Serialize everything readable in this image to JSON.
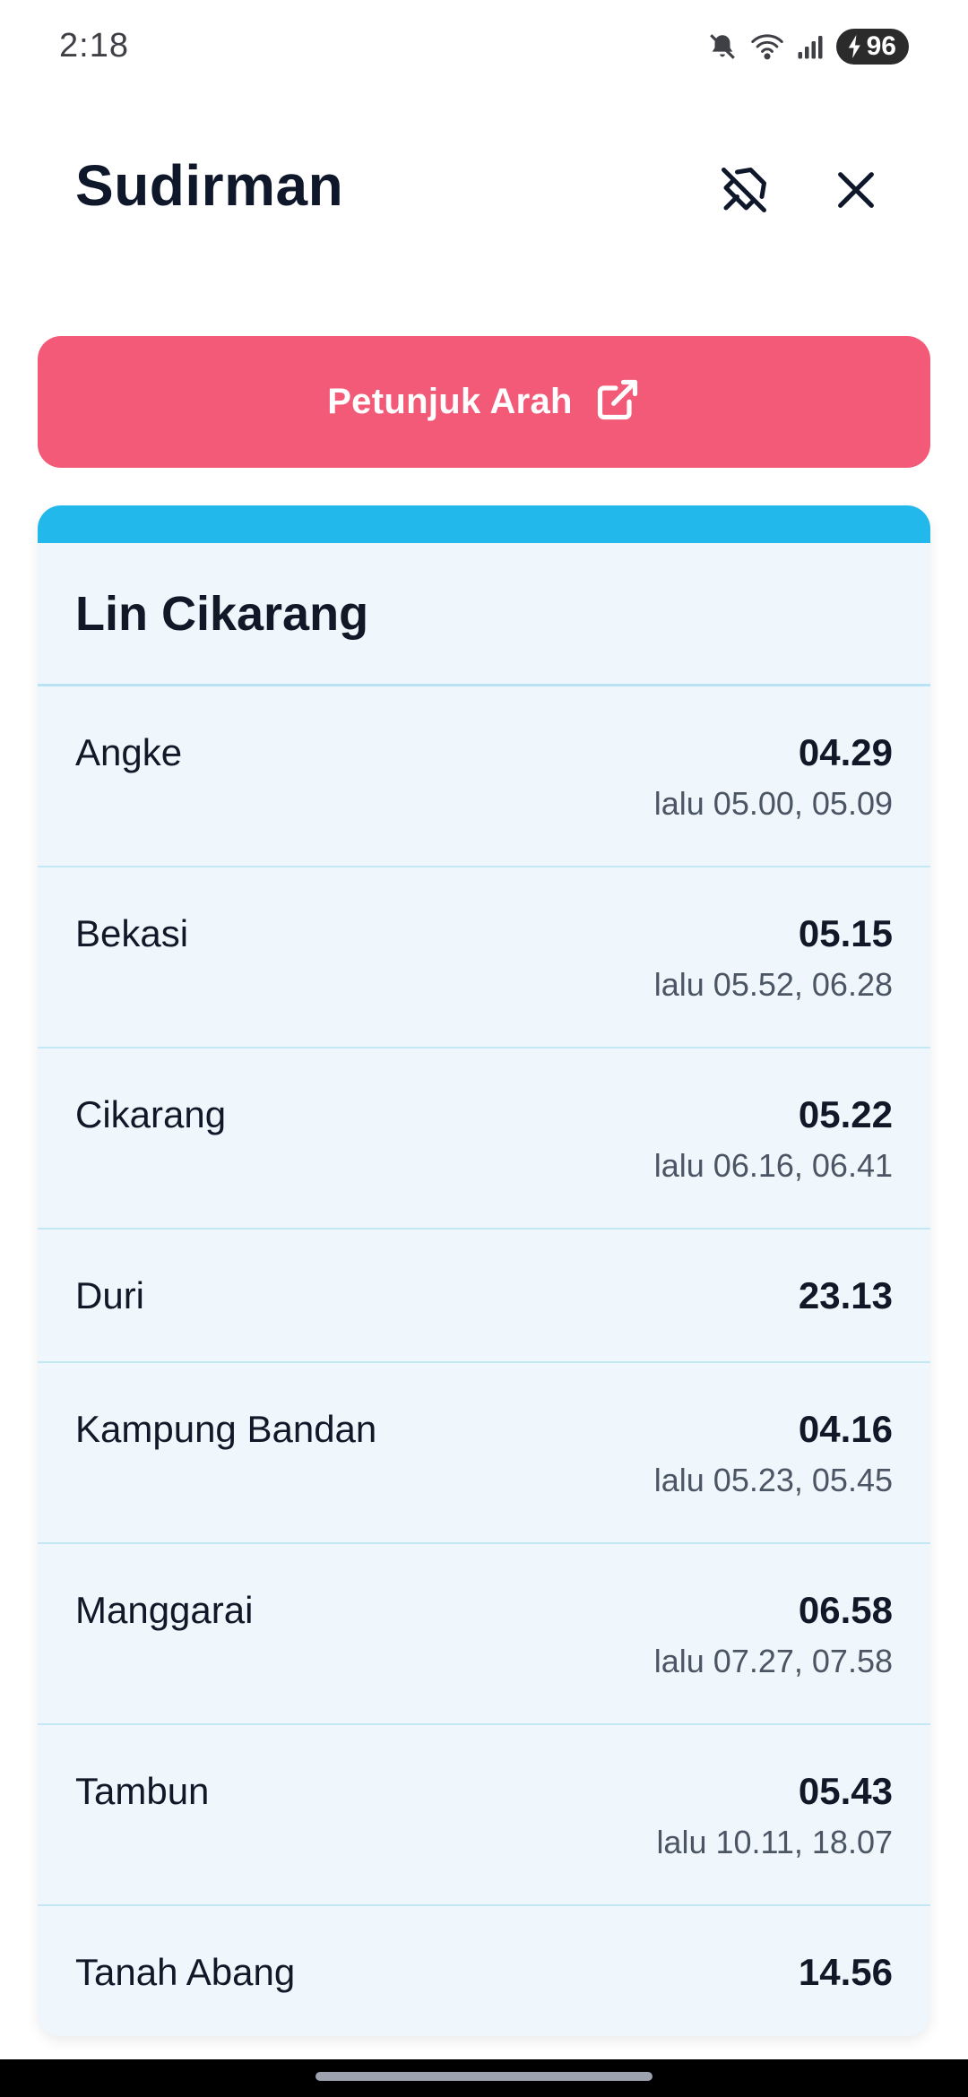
{
  "status_bar": {
    "time": "2:18",
    "battery_level": "96",
    "icons": [
      "mute-icon",
      "wifi-icon",
      "signal-icon",
      "battery-charging-icon"
    ]
  },
  "header": {
    "title": "Sudirman",
    "pin_icon": "pin-off-icon",
    "close_icon": "close-icon"
  },
  "directions_button": {
    "label": "Petunjuk Arah",
    "icon": "external-link-icon",
    "color": "#f25a77"
  },
  "line_card": {
    "title": "Lin Cikarang",
    "accent_color": "#23b8ec",
    "rows": [
      {
        "station": "Angke",
        "time": "04.29",
        "later": "lalu 05.00, 05.09"
      },
      {
        "station": "Bekasi",
        "time": "05.15",
        "later": "lalu 05.52, 06.28"
      },
      {
        "station": "Cikarang",
        "time": "05.22",
        "later": "lalu 06.16, 06.41"
      },
      {
        "station": "Duri",
        "time": "23.13",
        "later": ""
      },
      {
        "station": "Kampung Bandan",
        "time": "04.16",
        "later": "lalu 05.23, 05.45"
      },
      {
        "station": "Manggarai",
        "time": "06.58",
        "later": "lalu 07.27, 07.58"
      },
      {
        "station": "Tambun",
        "time": "05.43",
        "later": "lalu 10.11, 18.07"
      },
      {
        "station": "Tanah Abang",
        "time": "14.56",
        "later": ""
      }
    ]
  }
}
